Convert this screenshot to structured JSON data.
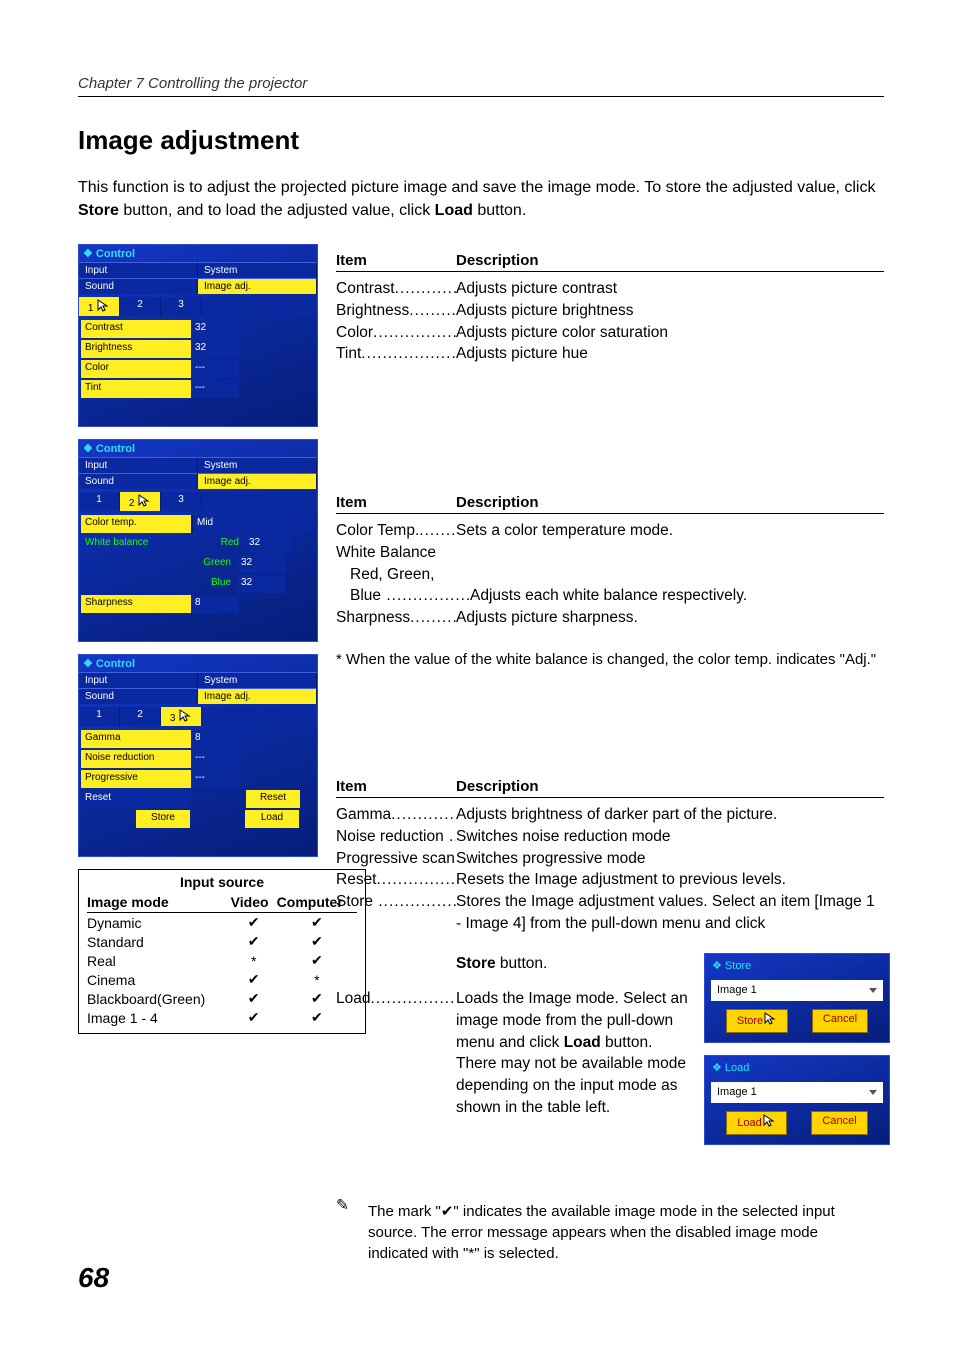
{
  "chapter": "Chapter 7 Controlling the projector",
  "heading": "Image  adjustment",
  "intro_a": "This function is to adjust the projected picture image and save the image mode. To store the adjusted value, click ",
  "intro_store": "Store",
  "intro_b": " button, and to load the adjusted value, click ",
  "intro_load": "Load",
  "intro_c": " button.",
  "panel": {
    "title": "Control",
    "tabs": {
      "input": "Input",
      "system": "System",
      "sound": "Sound",
      "image": "Image adj."
    },
    "nums": [
      "1",
      "2",
      "3"
    ],
    "p1": {
      "rows": [
        {
          "l": "Contrast",
          "v": "32"
        },
        {
          "l": "Brightness",
          "v": "32"
        },
        {
          "l": "Color",
          "v": "---"
        },
        {
          "l": "Tint",
          "v": "---"
        }
      ]
    },
    "p2": {
      "colortemp_l": "Color temp.",
      "colortemp_v": "Mid",
      "wb": "White balance",
      "red_l": "Red",
      "red_v": "32",
      "green_l": "Green",
      "green_v": "32",
      "blue_l": "Blue",
      "blue_v": "32",
      "sharp_l": "Sharpness",
      "sharp_v": "8"
    },
    "p3": {
      "rows": [
        {
          "l": "Gamma",
          "v": "8"
        },
        {
          "l": "Noise reduction",
          "v": "---"
        },
        {
          "l": "Progressive",
          "v": "---"
        }
      ],
      "reset_l": "Reset",
      "reset_btn": "Reset",
      "store_btn": "Store",
      "load_btn": "Load"
    }
  },
  "th": {
    "item": "Item",
    "desc": "Description"
  },
  "sec1": [
    {
      "l": "Contrast",
      "d": "Adjusts picture contrast"
    },
    {
      "l": "Brightness",
      "d": "Adjusts picture brightness"
    },
    {
      "l": "Color",
      "d": "Adjusts picture color saturation"
    },
    {
      "l": "Tint",
      "d": "Adjusts picture hue"
    }
  ],
  "sec2": {
    "colortemp_l": "Color Temp.",
    "colortemp_d": "Sets a color temperature mode.",
    "wb": "White Balance",
    "rgb": "Red, Green,",
    "blue": "Blue",
    "blue_d": "Adjusts each white balance respectively.",
    "sharp_l": "Sharpness",
    "sharp_d": "Adjusts picture sharpness.",
    "note": "* When the value of the white balance is changed, the color temp. indicates \"Adj.\""
  },
  "sec3": {
    "rows": [
      {
        "l": "Gamma",
        "d": "Adjusts brightness of darker part of the picture."
      },
      {
        "l": "Noise reduction",
        "d": "Switches noise reduction mode"
      },
      {
        "l": "Progressive scan",
        "d": "Switches progressive mode"
      },
      {
        "l": "Reset",
        "d": "Resets the Image adjustment to previous levels."
      }
    ],
    "store_l": "Store",
    "store_d1": "Stores the Image adjustment values. Select an item [Image 1 - Image 4] from the pull-down menu and click ",
    "store_b": "Store",
    "store_d2": " button.",
    "load_l": "Load",
    "load_d1": "Loads the Image mode. Select an image mode from the pull-down menu and click ",
    "load_b": "Load",
    "load_d2": " button. There may not be available mode depending on the input mode as shown in the table left."
  },
  "storebox": {
    "title": "Store",
    "option": "Image 1",
    "b1": "Store",
    "b2": "Cancel"
  },
  "loadbox": {
    "title": "Load",
    "option": "Image 1",
    "b1": "Load",
    "b2": "Cancel"
  },
  "table": {
    "header": "Input source",
    "cols": [
      "Image mode",
      "Video",
      "Computer"
    ],
    "rows": [
      {
        "n": "Dynamic",
        "v": "✔",
        "c": "✔"
      },
      {
        "n": "Standard",
        "v": "✔",
        "c": "✔"
      },
      {
        "n": "Real",
        "v": "*",
        "c": "✔"
      },
      {
        "n": "Cinema",
        "v": "✔",
        "c": "*"
      },
      {
        "n": "Blackboard(Green)",
        "v": "✔",
        "c": "✔"
      },
      {
        "n": "Image 1 - 4",
        "v": "✔",
        "c": "✔"
      }
    ]
  },
  "footnote": "The mark \"✔\" indicates the available image mode in the selected input source. The error message appears when the disabled image mode indicated with \"*\" is selected.",
  "pagenum": "68"
}
